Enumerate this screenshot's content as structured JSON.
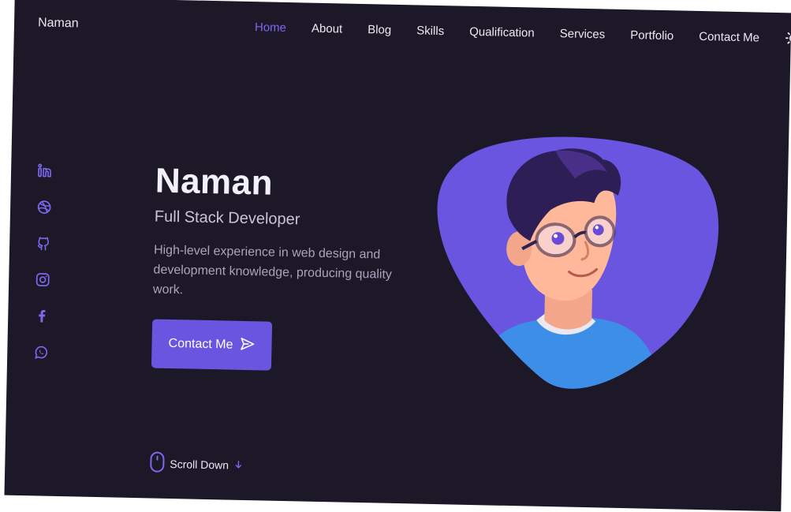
{
  "brand": "Naman",
  "nav": [
    {
      "label": "Home",
      "active": true
    },
    {
      "label": "About",
      "active": false
    },
    {
      "label": "Blog",
      "active": false
    },
    {
      "label": "Skills",
      "active": false
    },
    {
      "label": "Qualification",
      "active": false
    },
    {
      "label": "Services",
      "active": false
    },
    {
      "label": "Portfolio",
      "active": false
    },
    {
      "label": "Contact Me",
      "active": false
    }
  ],
  "social": [
    "linkedin-icon",
    "dribbble-icon",
    "github-icon",
    "instagram-icon",
    "facebook-icon",
    "whatsapp-icon"
  ],
  "hero": {
    "title": "Naman",
    "subtitle": "Full Stack Developer",
    "description": "High-level experience in web design and development knowledge, producing quality work.",
    "button_label": "Contact Me"
  },
  "scroll": {
    "label": "Scroll Down"
  },
  "colors": {
    "background": "#1c1827",
    "accent": "#6a55e0",
    "text": "#ece9f5",
    "muted": "#a9a4bd"
  }
}
